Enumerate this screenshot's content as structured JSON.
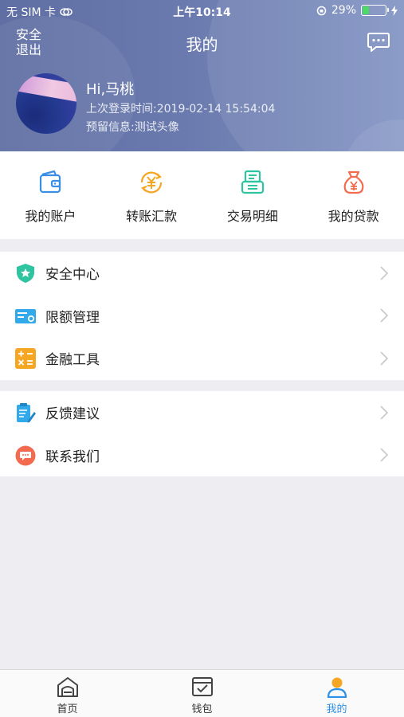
{
  "status_bar": {
    "carrier": "无 SIM 卡",
    "time": "上午10:14",
    "battery_percent": "29%",
    "battery_level": 0.29
  },
  "header": {
    "logout_label": "安全退出",
    "title": "我的",
    "message_icon": "chat-bubble-icon"
  },
  "user": {
    "greeting": "Hi,马桃",
    "last_login": "上次登录时间:2019-02-14 15:54:04",
    "reserved_info": "预留信息:测试头像"
  },
  "quick_actions": [
    {
      "label": "我的账户",
      "icon": "wallet-icon",
      "color": "#3a8ee6"
    },
    {
      "label": "转账汇款",
      "icon": "transfer-yuan-icon",
      "color": "#f5a623"
    },
    {
      "label": "交易明细",
      "icon": "receipt-printer-icon",
      "color": "#2ec4a0"
    },
    {
      "label": "我的贷款",
      "icon": "money-bag-icon",
      "color": "#f26b4f"
    }
  ],
  "menu_group_1": [
    {
      "label": "安全中心",
      "icon": "shield-star-icon",
      "color": "#2ec4a0"
    },
    {
      "label": "限额管理",
      "icon": "limit-card-icon",
      "color": "#32a9e8"
    },
    {
      "label": "金融工具",
      "icon": "calculator-icon",
      "color": "#f5a623"
    }
  ],
  "menu_group_2": [
    {
      "label": "反馈建议",
      "icon": "feedback-clipboard-icon",
      "color": "#32a9e8"
    },
    {
      "label": "联系我们",
      "icon": "contact-chat-icon",
      "color": "#f26b4f"
    }
  ],
  "tabbar": [
    {
      "label": "首页",
      "icon": "home-icon",
      "active": false
    },
    {
      "label": "钱包",
      "icon": "wallet-check-icon",
      "active": false
    },
    {
      "label": "我的",
      "icon": "user-profile-icon",
      "active": true
    }
  ],
  "colors": {
    "accent": "#2c8fe8",
    "header_bg": "#6a7aae",
    "page_bg": "#eeeef2"
  }
}
